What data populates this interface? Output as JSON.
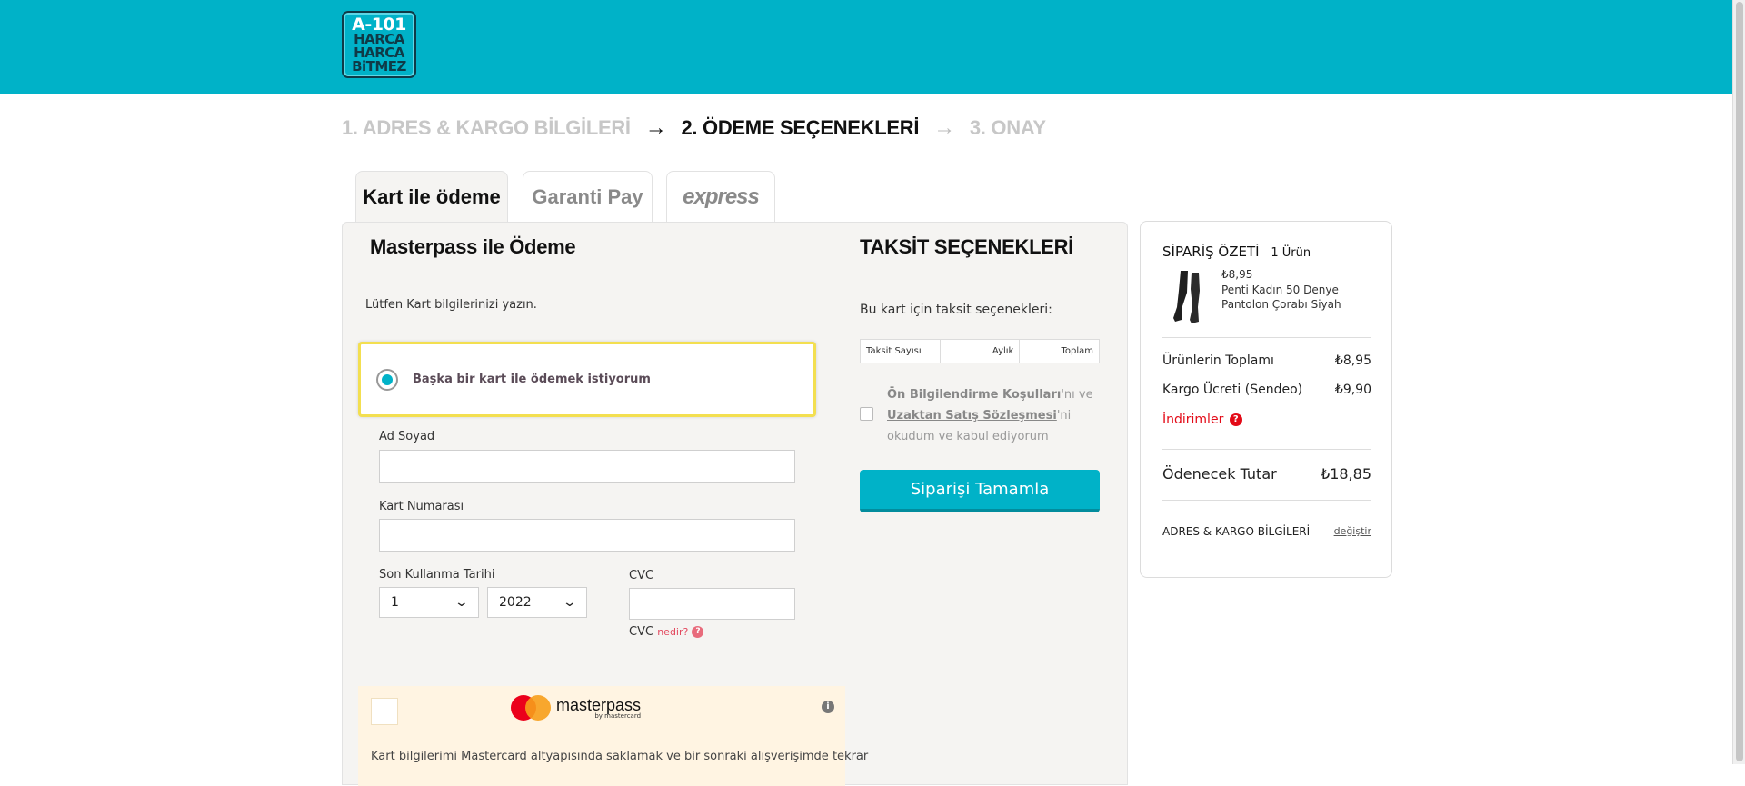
{
  "header": {
    "logo": [
      "A-101",
      "HARCA",
      "HARCA",
      "BiTMEZ"
    ]
  },
  "steps": {
    "step1": "1. ADRES & KARGO BİLGİLERİ",
    "step2": "2. ÖDEME SEÇENEKLERİ",
    "step3": "3. ONAY"
  },
  "tabs": {
    "card": "Kart ile ödeme",
    "garanti": "Garanti Pay",
    "express": "express"
  },
  "payment": {
    "title": "Masterpass ile Ödeme",
    "instruction": "Lütfen Kart bilgilerinizi yazın.",
    "other_card_label": "Başka bir kart ile ödemek istiyorum",
    "name_label": "Ad Soyad",
    "name_value": "",
    "card_number_label": "Kart Numarası",
    "card_number_value": "",
    "expiry_label": "Son Kullanma Tarihi",
    "expiry_month": "1",
    "expiry_year": "2022",
    "cvc_label": "CVC",
    "cvc_value": "",
    "cvc_help_label": "CVC",
    "cvc_help_link": "nedir?",
    "masterpass_name": "masterpass",
    "masterpass_by": "by mastercard",
    "masterpass_note": "Kart bilgilerimi Mastercard altyapısında saklamak ve bir sonraki alışverişimde tekrar"
  },
  "installments": {
    "title": "TAKSİT SEÇENEKLERİ",
    "subtitle": "Bu kart için taksit seçenekleri:",
    "col_count": "Taksit Sayısı",
    "col_monthly": "Aylık",
    "col_total": "Toplam",
    "agree_link1": "Ön Bilgilendirme Koşulları",
    "agree_text1": "'nı ve",
    "agree_link2": "Uzaktan Satış Sözleşmesi",
    "agree_text2": "'ni okudum ve kabul ediyorum",
    "complete_button": "Siparişi Tamamla"
  },
  "summary": {
    "title": "SİPARİŞ ÖZETİ",
    "count": "1 Ürün",
    "product_price": "₺8,95",
    "product_name": "Penti Kadın 50 Denye Pantolon Çorabı Siyah",
    "subtotal_label": "Ürünlerin Toplamı",
    "subtotal_value": "₺8,95",
    "shipping_label": "Kargo Ücreti (Sendeo)",
    "shipping_value": "₺9,90",
    "discounts_label": "İndirimler",
    "total_label": "Ödenecek Tutar",
    "total_value": "₺18,85",
    "address_label": "ADRES & KARGO BİLGİLERİ",
    "change_link": "değiştir"
  },
  "colors": {
    "brand": "#00b2c8",
    "highlight": "#f3df50",
    "discount": "#e30a17"
  }
}
